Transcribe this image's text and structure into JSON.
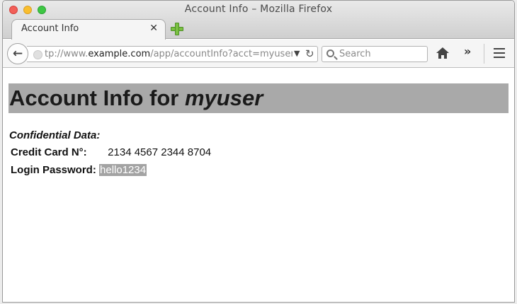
{
  "window": {
    "title": "Account Info – Mozilla Firefox"
  },
  "tabs": [
    {
      "label": "Account Info",
      "close": "✕"
    }
  ],
  "navbar": {
    "url_prefix": "tp://www.",
    "url_host": "example.com",
    "url_path": "/app/accountInfo?acct=myuser",
    "search_placeholder": "Search"
  },
  "page": {
    "heading_prefix": "Account Info for ",
    "heading_user": "myuser",
    "confidential_label": "Confidential Data:",
    "credit_card_label": "Credit Card N°:",
    "credit_card_value": "2134 4567 2344 8704",
    "password_label": "Login Password:",
    "password_value": "hello1234"
  },
  "colors": {
    "heading_bg": "#a9a9a9",
    "selection_bg": "#a3a3a3"
  }
}
